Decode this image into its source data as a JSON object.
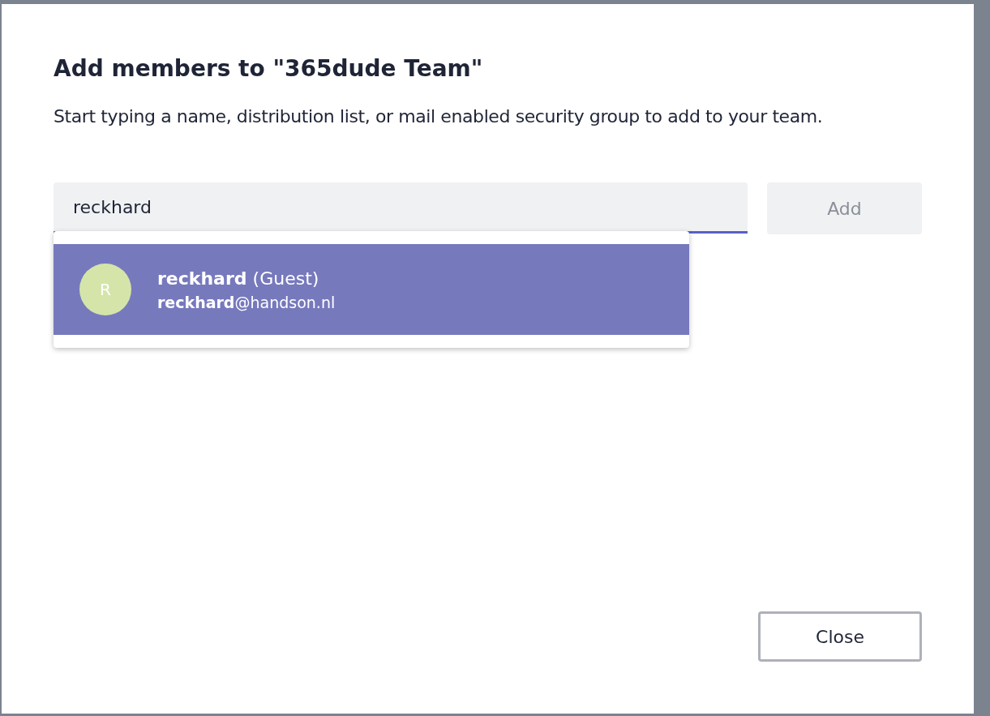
{
  "dialog": {
    "title": "Add members to \"365dude Team\"",
    "description": "Start typing a name, distribution list, or mail enabled security group to add to your team."
  },
  "search": {
    "value": "reckhard"
  },
  "add_button": {
    "label": "Add",
    "disabled": true
  },
  "suggestions": [
    {
      "initial": "R",
      "name": "**reckhard** (Guest)",
      "email": "**reckhard**@handson.nl",
      "selected": true
    }
  ],
  "close_button": {
    "label": "Close"
  }
}
